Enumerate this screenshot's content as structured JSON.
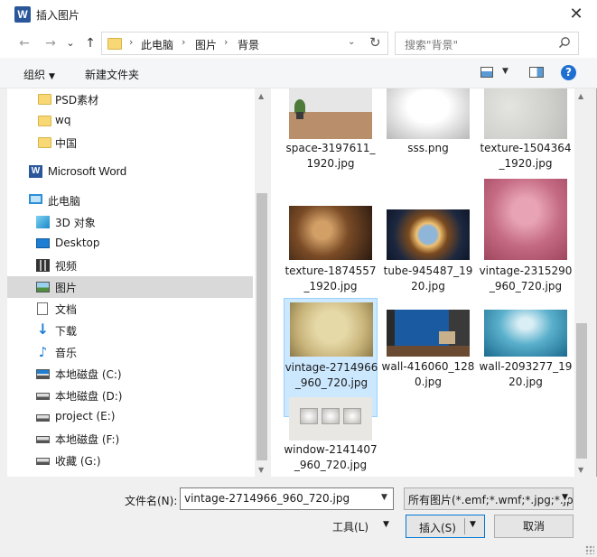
{
  "window": {
    "title": "插入图片",
    "app_icon_letter": "W",
    "close_glyph": "✕"
  },
  "nav": {
    "back_glyph": "←",
    "forward_glyph": "→",
    "history_glyph": "⌄",
    "up_glyph": "↑",
    "breadcrumb": [
      "此电脑",
      "图片",
      "背景"
    ],
    "separator": "›",
    "dropdown_glyph": "⌄",
    "refresh_glyph": "↻",
    "search_placeholder": "搜索\"背景\""
  },
  "toolbar": {
    "organize_label": "组织",
    "new_folder_label": "新建文件夹",
    "caret": "▼",
    "help_glyph": "?"
  },
  "sidebar": {
    "items": [
      {
        "label": "PSD素材",
        "icon": "folder-icon"
      },
      {
        "label": "wq",
        "icon": "folder-icon"
      },
      {
        "label": "中国",
        "icon": "folder-icon"
      },
      {
        "label": "Microsoft Word",
        "icon": "word-icon"
      },
      {
        "label": "此电脑",
        "icon": "computer-icon"
      },
      {
        "label": "3D 对象",
        "icon": "cube-icon"
      },
      {
        "label": "Desktop",
        "icon": "desktop-icon"
      },
      {
        "label": "视频",
        "icon": "video-icon"
      },
      {
        "label": "图片",
        "icon": "pictures-icon",
        "selected": true
      },
      {
        "label": "文档",
        "icon": "document-icon"
      },
      {
        "label": "下载",
        "icon": "download-icon"
      },
      {
        "label": "音乐",
        "icon": "music-icon"
      },
      {
        "label": "本地磁盘 (C:)",
        "icon": "system-drive-icon"
      },
      {
        "label": "本地磁盘 (D:)",
        "icon": "drive-icon"
      },
      {
        "label": "project (E:)",
        "icon": "drive-icon"
      },
      {
        "label": "本地磁盘 (F:)",
        "icon": "drive-icon"
      },
      {
        "label": "收藏 (G:)",
        "icon": "drive-icon"
      }
    ]
  },
  "files": [
    {
      "caption": "space-3197611_1920.jpg",
      "thumb": "room-floor"
    },
    {
      "caption": "sss.png",
      "thumb": "white-room"
    },
    {
      "caption": "texture-1504364_1920.jpg",
      "thumb": "plaster"
    },
    {
      "caption": "texture-1874557_1920.jpg",
      "thumb": "grunge-brown"
    },
    {
      "caption": "tube-945487_1920.jpg",
      "thumb": "tube"
    },
    {
      "caption": "vintage-2315290_960_720.jpg",
      "thumb": "pink-grunge"
    },
    {
      "caption": "vintage-2714966_960_720.jpg",
      "thumb": "parchment",
      "selected": true
    },
    {
      "caption": "wall-416060_1280.jpg",
      "thumb": "blue-room"
    },
    {
      "caption": "wall-2093277_1920.jpg",
      "thumb": "blue-gradient"
    },
    {
      "caption": "window-2141407_960_720.jpg",
      "thumb": "windows-wall"
    }
  ],
  "footer": {
    "filename_label": "文件名(N):",
    "filename_value": "vintage-2714966_960_720.jpg",
    "filter_value": "所有图片(*.emf;*.wmf;*.jpg;*.jp",
    "tools_label": "工具(L)",
    "insert_label": "插入(S)",
    "cancel_label": "取消",
    "caret": "▼"
  }
}
